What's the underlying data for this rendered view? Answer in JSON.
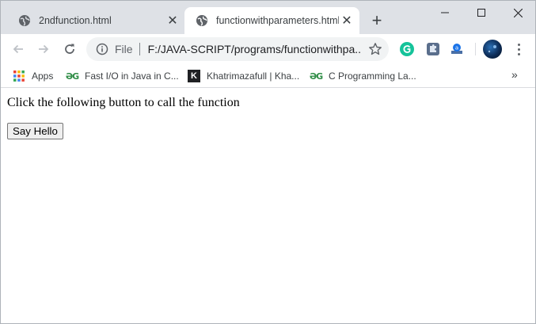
{
  "tabs": [
    {
      "title": "2ndfunction.html",
      "active": false,
      "icon": "globe-icon"
    },
    {
      "title": "functionwithparameters.html",
      "active": true,
      "icon": "globe-icon"
    }
  ],
  "toolbar": {
    "scheme_label": "File",
    "url": "F:/JAVA-SCRIPT/programs/functionwithpa..."
  },
  "bookmarks": {
    "apps_label": "Apps",
    "items": [
      {
        "label": "Fast I/O in Java in C...",
        "icon": "geeksforgeeks-icon"
      },
      {
        "label": "Khatrimazafull | Kha...",
        "icon": "k-icon"
      },
      {
        "label": "C Programming La...",
        "icon": "geeksforgeeks-icon"
      }
    ],
    "more": "»"
  },
  "page": {
    "paragraph": "Click the following button to call the function",
    "button_label": "Say Hello"
  },
  "colors": {
    "tabstrip": "#dee1e6",
    "omnibox": "#f1f3f4",
    "grammarly": "#15c39a",
    "gfg_green": "#2f8d46"
  }
}
